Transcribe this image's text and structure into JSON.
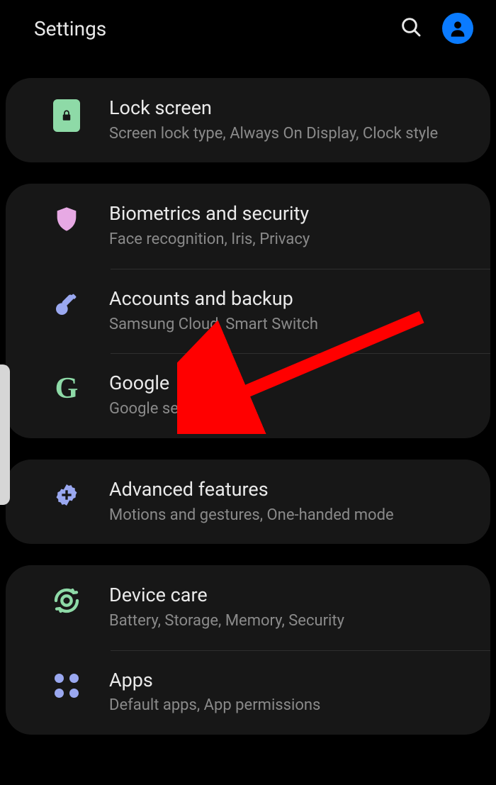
{
  "header": {
    "title": "Settings"
  },
  "groups": [
    {
      "items": [
        {
          "title": "Lock screen",
          "subtitle": "Screen lock type, Always On Display, Clock style"
        }
      ]
    },
    {
      "items": [
        {
          "title": "Biometrics and security",
          "subtitle": "Face recognition, Iris, Privacy"
        },
        {
          "title": "Accounts and backup",
          "subtitle": "Samsung Cloud, Smart Switch"
        },
        {
          "title": "Google",
          "subtitle": "Google settings"
        }
      ]
    },
    {
      "items": [
        {
          "title": "Advanced features",
          "subtitle": "Motions and gestures, One-handed mode"
        }
      ]
    },
    {
      "items": [
        {
          "title": "Device care",
          "subtitle": "Battery, Storage, Memory, Security"
        },
        {
          "title": "Apps",
          "subtitle": "Default apps, App permissions"
        }
      ]
    }
  ],
  "colors": {
    "mint": "#8edaa7",
    "pink": "#e7a9e4",
    "periwinkle": "#9aa8f0",
    "blue": "#0a7bff",
    "arrow": "#ff0000"
  }
}
